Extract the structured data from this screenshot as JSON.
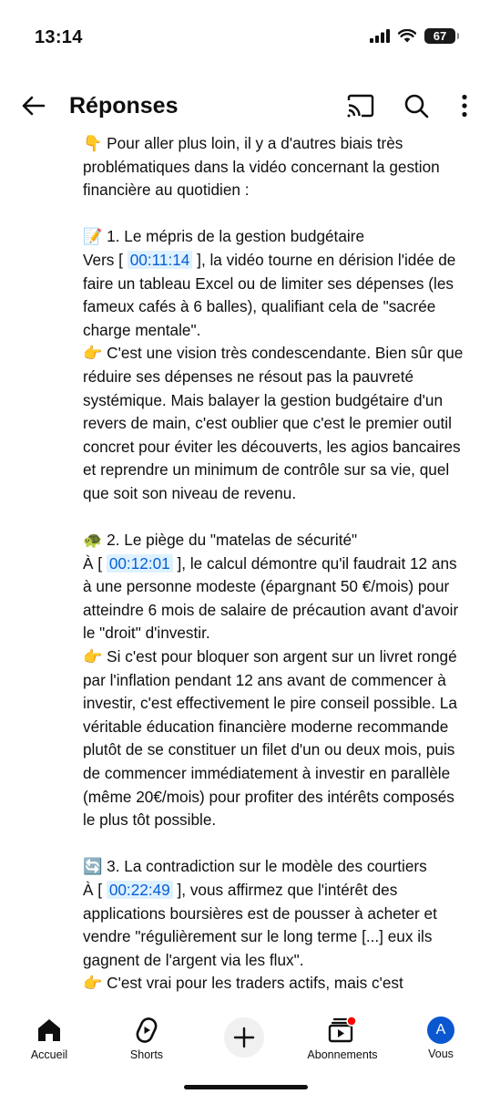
{
  "status_bar": {
    "time": "13:14",
    "battery": "67"
  },
  "header": {
    "title": "Réponses"
  },
  "comment": {
    "p1": "👇 Pour aller plus loin, il y a d'autres biais très problématiques dans la vidéo concernant la gestion financière au quotidien :",
    "s1_title": "📝 1. Le mépris de la gestion budgétaire",
    "s1_pre": "Vers ",
    "s1_ts": "00:11:14",
    "s1_post": ", la vidéo tourne en dérision l'idée de faire un tableau Excel ou de limiter ses dépenses (les fameux cafés à 6 balles), qualifiant cela de \"sacrée charge mentale\".",
    "s1_comment": "👉 C'est une vision très condescendante. Bien sûr que réduire ses dépenses ne résout pas la pauvreté systémique. Mais balayer la gestion budgétaire d'un revers de main, c'est oublier que c'est le premier outil concret pour éviter les découverts, les agios bancaires et reprendre un minimum de contrôle sur sa vie, quel que soit son niveau de revenu.",
    "s2_title": "🐢 2. Le piège du \"matelas de sécurité\"",
    "s2_pre": "À ",
    "s2_ts": "00:12:01",
    "s2_post": ", le calcul démontre qu'il faudrait 12 ans à une personne modeste (épargnant 50 €/mois) pour atteindre 6 mois de salaire de précaution avant d'avoir le \"droit\" d'investir.",
    "s2_comment": "👉 Si c'est pour bloquer son argent sur un livret rongé par l'inflation pendant 12 ans avant de commencer à investir, c'est effectivement le pire conseil possible. La véritable éducation financière moderne recommande plutôt de se constituer un filet d'un ou deux mois, puis de commencer immédiatement à investir en parallèle (même 20€/mois) pour profiter des intérêts composés le plus tôt possible.",
    "s3_title": "🔄 3. La contradiction sur le modèle des courtiers",
    "s3_pre": "À ",
    "s3_ts": "00:22:49",
    "s3_post": ", vous affirmez que l'intérêt des applications boursières est de pousser à acheter et vendre \"régulièrement sur le long terme [...] eux ils gagnent de l'argent via les flux\".",
    "s3_comment": "👉 C'est vrai pour les traders actifs, mais c'est"
  },
  "nav": {
    "home": "Accueil",
    "shorts": "Shorts",
    "subscriptions": "Abonnements",
    "you": "Vous",
    "avatar_letter": "A"
  },
  "colors": {
    "timestamp_text": "#065fd4",
    "timestamp_bg": "#def1ff",
    "avatar_bg": "#0b57d0",
    "notification_dot": "#ff0000"
  }
}
